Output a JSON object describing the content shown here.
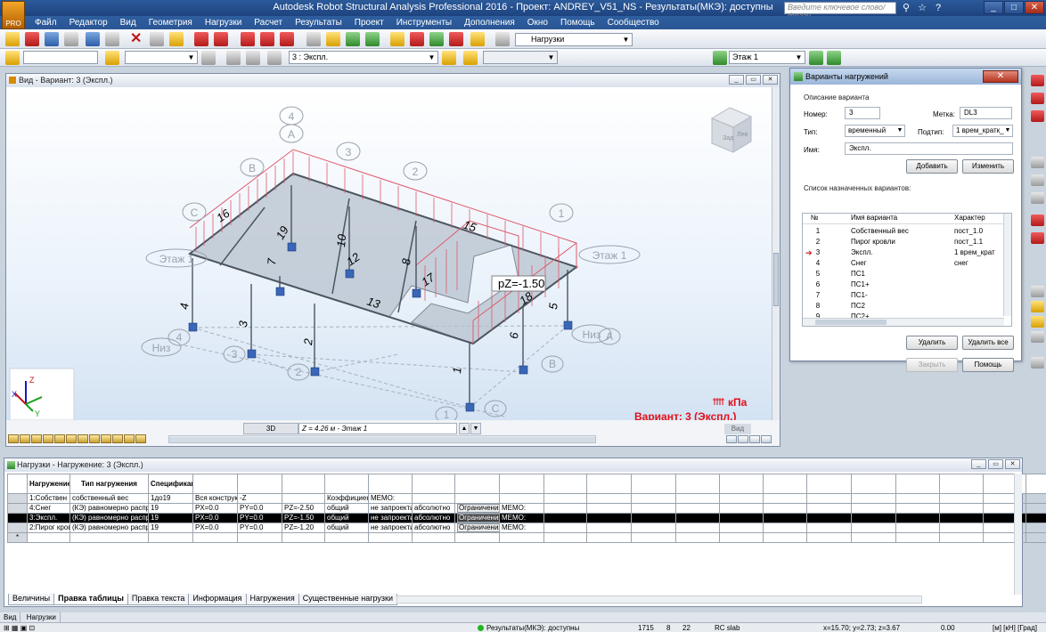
{
  "app": {
    "title": "Autodesk Robot Structural Analysis Professional 2016 - Проект: ANDREY_V51_NS - Результаты(МКЭ): доступны",
    "search_placeholder": "Введите ключевое слово/фразу",
    "logo_text": "PRO"
  },
  "menu": [
    "Файл",
    "Редактор",
    "Вид",
    "Геометрия",
    "Нагрузки",
    "Расчет",
    "Результаты",
    "Проект",
    "Инструменты",
    "Дополнения",
    "Окно",
    "Помощь",
    "Сообщество"
  ],
  "toolbar": {
    "loads_combo": "Нагрузки",
    "case_combo": "3 : Экспл.",
    "storey_combo": "Этаж 1"
  },
  "view": {
    "title": "Вид - Вариант: 3 (Экспл.)",
    "units": "кПа",
    "variant_label": "Вариант: 3 (Экспл.)",
    "pz_label": "pZ=-1.50",
    "mode": "3D",
    "z_level": "Z = 4.26 м - Этаж 1",
    "vid_label": "Вид",
    "grid_labels": [
      "4",
      "3",
      "2",
      "1",
      "A",
      "B",
      "C",
      "Этаж 1",
      "Этаж 1",
      "Низ",
      "Низ",
      "4",
      "3",
      "2",
      "1",
      "A",
      "B",
      "C"
    ],
    "bar_labels": [
      "16",
      "15",
      "13",
      "17",
      "10",
      "12",
      "8",
      "7",
      "19",
      "18",
      "4",
      "3",
      "2",
      "1",
      "5",
      "6"
    ],
    "axes": {
      "x": "X",
      "y": "Y",
      "z": "Z"
    },
    "cube_faces": {
      "top": "Зад",
      "front": "Лев"
    }
  },
  "dialog": {
    "title": "Варианты нагружений",
    "group_desc": "Описание варианта",
    "number_label": "Номер:",
    "number_value": "3",
    "mark_label": "Метка:",
    "mark_value": "DL3",
    "type_label": "Тип:",
    "type_value": "временный",
    "subtype_label": "Подтип:",
    "subtype_value": "1 врем_кратк_",
    "name_label": "Имя:",
    "name_value": "Экспл.",
    "add_button": "Добавить",
    "modify_button": "Изменить",
    "list_label": "Список назначенных вариантов:",
    "list_headers": {
      "no": "№",
      "name": "Имя варианта",
      "char": "Характер"
    },
    "cases": [
      {
        "no": "1",
        "name": "Собственный вес",
        "char": "пост_1.0"
      },
      {
        "no": "2",
        "name": "Пирог кровли",
        "char": "пост_1.1"
      },
      {
        "no": "3",
        "name": "Экспл.",
        "char": "1 врем_крат"
      },
      {
        "no": "4",
        "name": "Снег",
        "char": "снег"
      },
      {
        "no": "5",
        "name": "ПС1",
        "char": ""
      },
      {
        "no": "6",
        "name": "ПС1+",
        "char": ""
      },
      {
        "no": "7",
        "name": "ПС1-",
        "char": ""
      },
      {
        "no": "8",
        "name": "ПС2",
        "char": ""
      },
      {
        "no": "9",
        "name": "ПС2+",
        "char": ""
      }
    ],
    "delete_button": "Удалить",
    "delete_all_button": "Удалить все",
    "close_button": "Закрыть",
    "help_button": "Помощь"
  },
  "table": {
    "title": "Нагрузки - Нагружение: 3 (Экспл.)",
    "headers": [
      "Нагружение",
      "Тип нагружения",
      "Спецификация",
      "",
      "",
      "",
      "",
      "",
      "",
      "",
      "",
      "",
      "",
      "",
      "",
      "",
      "",
      "",
      "",
      "",
      "",
      "",
      "",
      ""
    ],
    "rows": [
      [
        "1:Собствен",
        "собственный вес",
        "1до19",
        "Вся конструк",
        "-Z",
        "",
        "Коэффициен",
        "MEMO:",
        "",
        "",
        "",
        "",
        "",
        "",
        "",
        "",
        "",
        "",
        "",
        "",
        "",
        "",
        "",
        ""
      ],
      [
        "4:Снег",
        "(КЭ) равномерно распр",
        "19",
        "PX=0.0",
        "PY=0.0",
        "PZ=-2.50",
        "общий",
        "не запроекти",
        "абсолютно",
        "Ограничения",
        "MEMO:",
        "",
        "",
        "",
        "",
        "",
        "",
        "",
        "",
        "",
        "",
        "",
        "",
        ""
      ],
      [
        "3:Экспл.",
        "(КЭ) равномерно распр",
        "19",
        "PX=0.0",
        "PY=0.0",
        "PZ=-1.50",
        "общий",
        "не запроекти",
        "абсолютно",
        "Ограничения",
        "MEMO:",
        "",
        "",
        "",
        "",
        "",
        "",
        "",
        "",
        "",
        "",
        "",
        "",
        ""
      ],
      [
        "2:Пирог кров",
        "(КЭ) равномерно распр",
        "19",
        "PX=0.0",
        "PY=0.0",
        "PZ=-1.20",
        "общий",
        "не запроекти",
        "абсолютно",
        "Ограничения",
        "MEMO:",
        "",
        "",
        "",
        "",
        "",
        "",
        "",
        "",
        "",
        "",
        "",
        "",
        ""
      ]
    ],
    "tabs": [
      "Величины",
      "Правка таблицы",
      "Правка текста",
      "Информация",
      "Нагружения",
      "Существенные нагрузки"
    ]
  },
  "bottom_tabs": [
    "Вид",
    "Нагрузки"
  ],
  "status": {
    "results": "Результаты(МКЭ): доступны",
    "n1": "1715",
    "n2": "8",
    "n3": "22",
    "section": "RC slab",
    "coords": "x=15.70; y=2.73; z=3.67",
    "value": "0.00",
    "units": "[м] [кН] [Град]"
  },
  "colors": {
    "accent": "#2b5a9a",
    "load": "#e05a6a",
    "variant_text": "#e0101a",
    "axis_x": "#c01818",
    "axis_y": "#18a018",
    "axis_z": "#1818c0"
  }
}
